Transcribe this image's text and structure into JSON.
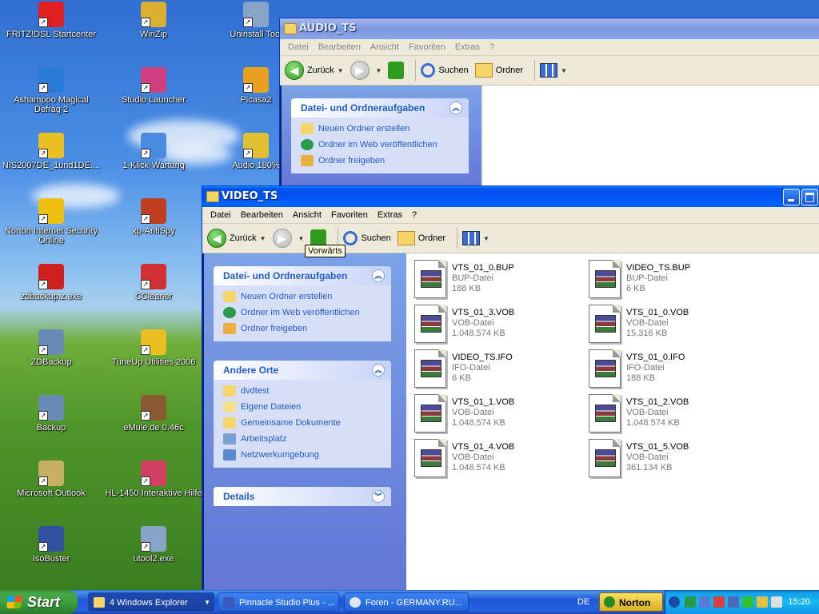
{
  "desktop_icons": [
    {
      "label": "FRITZ!DSL Startcenter",
      "icon": "fritz-icon",
      "color": "#e02020"
    },
    {
      "label": "WinZip",
      "icon": "winzip-icon",
      "color": "#d9b030"
    },
    {
      "label": "Uninstall Tool",
      "icon": "uninstall-tool-icon",
      "color": "#8aa4c8"
    },
    {
      "label": "Ashampoo Magical Defrag 2",
      "icon": "ashampoo-defrag-icon",
      "color": "#2a7ad8"
    },
    {
      "label": "Studio Launcher",
      "icon": "studio-launcher-icon",
      "color": "#d04080"
    },
    {
      "label": "Picasa2",
      "icon": "picasa-icon",
      "color": "#e8a020"
    },
    {
      "label": "NIS2007DE_1und1DE....",
      "icon": "nis-installer-icon",
      "color": "#e8c020"
    },
    {
      "label": "1-Klick-Wartung",
      "icon": "one-click-maintenance-icon",
      "color": "#4a8ae0"
    },
    {
      "label": "Audio 180%",
      "icon": "audio-icon",
      "color": "#e0c030"
    },
    {
      "label": "Norton Internet Security Online",
      "icon": "norton-icon",
      "color": "#f0c010"
    },
    {
      "label": "xp-AntiSpy",
      "icon": "xp-antispy-icon",
      "color": "#c04020"
    },
    {
      "label": "zdbackup.z.exe",
      "icon": "zdbackup-exe-icon",
      "color": "#d02020"
    },
    {
      "label": "CCleaner",
      "icon": "ccleaner-icon",
      "color": "#d03030"
    },
    {
      "label": "ZDBackup",
      "icon": "zdbackup-icon",
      "color": "#6a8ab8"
    },
    {
      "label": "TuneUp Utilities 2006",
      "icon": "tuneup-icon",
      "color": "#e8c020"
    },
    {
      "label": "Backup",
      "icon": "backup-icon",
      "color": "#6a8ab8"
    },
    {
      "label": "eMule.de 0.46c",
      "icon": "emule-icon",
      "color": "#8a5a30"
    },
    {
      "label": "Microsoft Outlook",
      "icon": "outlook-icon",
      "color": "#c8b060"
    },
    {
      "label": "HL-1450 Interaktive Hilfe",
      "icon": "hl1450-help-icon",
      "color": "#d04060"
    },
    {
      "label": "IsoBuster",
      "icon": "isobuster-icon",
      "color": "#3050a0"
    },
    {
      "label": "utool2.exe",
      "icon": "utool-icon",
      "color": "#8aa4c8"
    }
  ],
  "audio_window": {
    "title": "AUDIO_TS",
    "menu": [
      "Datei",
      "Bearbeiten",
      "Ansicht",
      "Favoriten",
      "Extras",
      "?"
    ],
    "toolbar": {
      "back": "Zurück",
      "search": "Suchen",
      "folders": "Ordner"
    },
    "tasks_header": "Datei- und Ordneraufgaben",
    "tasks": [
      "Neuen Ordner erstellen",
      "Ordner im Web veröffentlichen",
      "Ordner freigeben"
    ]
  },
  "video_window": {
    "title": "VIDEO_TS",
    "menu": [
      "Datei",
      "Bearbeiten",
      "Ansicht",
      "Favoriten",
      "Extras",
      "?"
    ],
    "toolbar": {
      "back": "Zurück",
      "search": "Suchen",
      "folders": "Ordner"
    },
    "tooltip": "Vorwärts",
    "tasks_header": "Datei- und Ordneraufgaben",
    "tasks": [
      "Neuen Ordner erstellen",
      "Ordner im Web veröffentlichen",
      "Ordner freigeben"
    ],
    "places_header": "Andere Orte",
    "places": [
      "dvdtest",
      "Eigene Dateien",
      "Gemeinsame Dokumente",
      "Arbeitsplatz",
      "Netzwerkumgebung"
    ],
    "details_header": "Details",
    "files": [
      {
        "name": "VTS_01_0.BUP",
        "type": "BUP-Datei",
        "size": "188 KB"
      },
      {
        "name": "VIDEO_TS.BUP",
        "type": "BUP-Datei",
        "size": "6 KB"
      },
      {
        "name": "VTS_01_3.VOB",
        "type": "VOB-Datei",
        "size": "1.048.574 KB"
      },
      {
        "name": "VTS_01_0.VOB",
        "type": "VOB-Datei",
        "size": "15.316 KB"
      },
      {
        "name": "VIDEO_TS.IFO",
        "type": "IFO-Datei",
        "size": "6 KB"
      },
      {
        "name": "VTS_01_0.IFO",
        "type": "IFO-Datei",
        "size": "188 KB"
      },
      {
        "name": "VTS_01_1.VOB",
        "type": "VOB-Datei",
        "size": "1.048.574 KB"
      },
      {
        "name": "VTS_01_2.VOB",
        "type": "VOB-Datei",
        "size": "1.048.574 KB"
      },
      {
        "name": "VTS_01_4.VOB",
        "type": "VOB-Datei",
        "size": "1.048.574 KB"
      },
      {
        "name": "VTS_01_5.VOB",
        "type": "VOB-Datei",
        "size": "361.134 KB"
      }
    ]
  },
  "taskbar": {
    "start": "Start",
    "tasks": [
      "4 Windows Explorer",
      "Pinnacle Studio Plus - ...",
      "Foren - GERMANY.RU..."
    ],
    "language": "DE",
    "norton": "Norton",
    "clock": "15:20"
  }
}
